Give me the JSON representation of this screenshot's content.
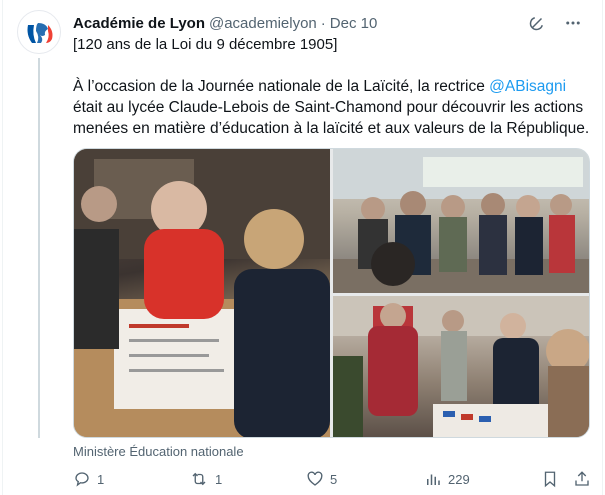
{
  "tweet": {
    "author": "Académie de Lyon",
    "handle": "@academielyon",
    "separator": "·",
    "date": "Dec 10",
    "reply_line": "[120 ans de la Loi du 9 décembre 1905]",
    "text_before": "À l’occasion de la Journée nationale de la Laïcité, la rectrice ",
    "mention": "@ABisagni",
    "text_after": " était au lycée Claude-Lebois de Saint-Chamond pour découvrir les actions menées en matière d’éducation à la laïcité et aux valeurs de la République.",
    "media_caption": "Ministère Éducation nationale"
  },
  "actions": {
    "replies": "1",
    "reposts": "1",
    "likes": "5",
    "views": "229"
  },
  "colors": {
    "accent": "#1d9bf0",
    "muted": "#536471",
    "text": "#0f1419",
    "logo_blue": "#0055a4",
    "logo_red": "#ef4135"
  },
  "icons": [
    "grok-icon",
    "more-icon",
    "reply-icon",
    "repost-icon",
    "like-icon",
    "views-icon",
    "bookmark-icon",
    "share-icon"
  ]
}
